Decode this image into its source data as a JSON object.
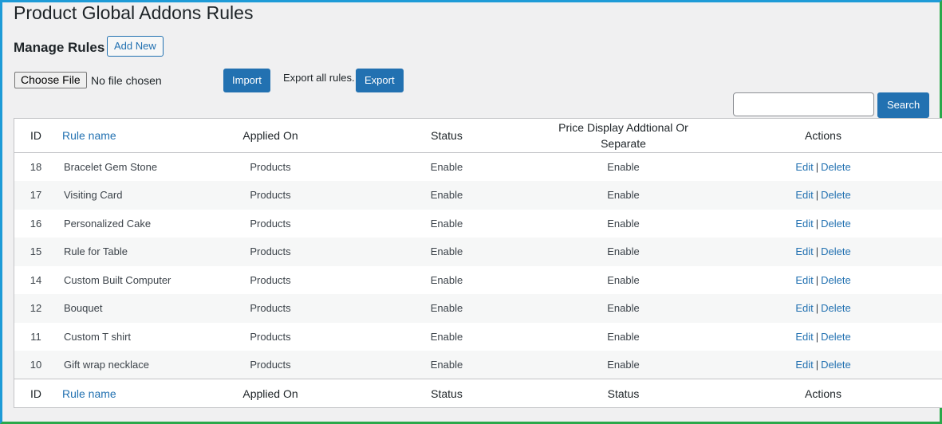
{
  "page": {
    "title": "Product Global Addons Rules",
    "manage_label": "Manage Rules",
    "add_new_label": "Add New"
  },
  "import_bar": {
    "choose_file_label": "Choose File",
    "file_status": "No file chosen",
    "import_label": "Import",
    "export_text": "Export all rules.",
    "export_label": "Export"
  },
  "search": {
    "value": "",
    "button_label": "Search"
  },
  "table": {
    "header": {
      "id": "ID",
      "rule_name": "Rule name",
      "applied_on": "Applied On",
      "status": "Status",
      "price_display_line1": "Price Display Addtional Or",
      "price_display_line2": "Separate",
      "actions": "Actions"
    },
    "footer": {
      "id": "ID",
      "rule_name": "Rule name",
      "applied_on": "Applied On",
      "status": "Status",
      "price_display": "Status",
      "actions": "Actions"
    },
    "rows": [
      {
        "id": "18",
        "name": "Bracelet Gem Stone",
        "applied_on": "Products",
        "status": "Enable",
        "price_display": "Enable",
        "edit": "Edit",
        "sep": "|",
        "delete": "Delete"
      },
      {
        "id": "17",
        "name": "Visiting Card",
        "applied_on": "Products",
        "status": "Enable",
        "price_display": "Enable",
        "edit": "Edit",
        "sep": "|",
        "delete": "Delete"
      },
      {
        "id": "16",
        "name": "Personalized Cake",
        "applied_on": "Products",
        "status": "Enable",
        "price_display": "Enable",
        "edit": "Edit",
        "sep": "|",
        "delete": "Delete"
      },
      {
        "id": "15",
        "name": "Rule for Table",
        "applied_on": "Products",
        "status": "Enable",
        "price_display": "Enable",
        "edit": "Edit",
        "sep": "|",
        "delete": "Delete"
      },
      {
        "id": "14",
        "name": "Custom Built Computer",
        "applied_on": "Products",
        "status": "Enable",
        "price_display": "Enable",
        "edit": "Edit",
        "sep": "|",
        "delete": "Delete"
      },
      {
        "id": "12",
        "name": "Bouquet",
        "applied_on": "Products",
        "status": "Enable",
        "price_display": "Enable",
        "edit": "Edit",
        "sep": "|",
        "delete": "Delete"
      },
      {
        "id": "11",
        "name": "Custom T shirt",
        "applied_on": "Products",
        "status": "Enable",
        "price_display": "Enable",
        "edit": "Edit",
        "sep": "|",
        "delete": "Delete"
      },
      {
        "id": "10",
        "name": "Gift wrap necklace",
        "applied_on": "Products",
        "status": "Enable",
        "price_display": "Enable",
        "edit": "Edit",
        "sep": "|",
        "delete": "Delete"
      }
    ]
  },
  "colors": {
    "accent": "#2271b1",
    "background": "#f0f0f1",
    "frame_top": "#1e9bd7",
    "frame_bottom": "#2aa84a"
  }
}
